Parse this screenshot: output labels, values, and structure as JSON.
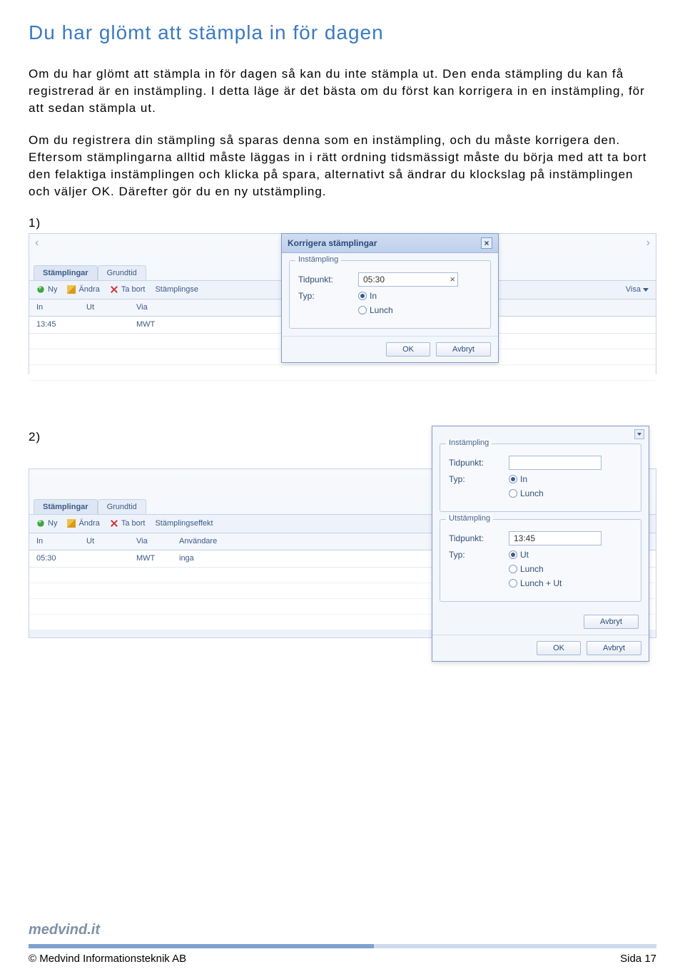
{
  "title": "Du har glömt att stämpla in för dagen",
  "para1": "Om du har glömt att stämpla in för dagen så kan du inte stämpla ut. Den enda stämpling du kan få registrerad är en instämpling. I detta läge är det bästa om du först kan korrigera in en instämpling, för att sedan stämpla ut.",
  "para2": "Om du registrera din stämpling så sparas denna som en instämpling, och du måste korrigera den. Eftersom stämplingarna alltid måste läggas in i rätt ordning tidsmässigt måste du börja med att ta bort den felaktiga instämplingen och klicka på spara, alternativt så ändrar du klockslag på instämplingen och väljer OK. Därefter gör du en ny utstämpling.",
  "step1": "1)",
  "step2": "2)",
  "common": {
    "tabs": {
      "stamplingar": "Stämplingar",
      "grundtid": "Grundtid"
    },
    "toolbar": {
      "ny": "Ny",
      "andra": "Ändra",
      "tabort": "Ta bort",
      "visa": "Visa"
    },
    "ok": "OK",
    "avbryt": "Avbryt",
    "tidpunkt": "Tidpunkt:",
    "typ": "Typ:"
  },
  "shot1": {
    "toolbar_effect": "Stämplingse",
    "headers": {
      "in": "In",
      "ut": "Ut",
      "via": "Via"
    },
    "row": {
      "in": "13:45",
      "ut": "",
      "via": "MWT"
    },
    "dialog": {
      "title": "Korrigera stämplingar",
      "legend": "Instämpling",
      "tidpunkt_value": "05:30",
      "in": "In",
      "lunch": "Lunch"
    }
  },
  "shot2": {
    "toolbar_effect": "Stämplingseffekt",
    "headers": {
      "in": "In",
      "ut": "Ut",
      "via": "Via",
      "anv": "Användare"
    },
    "row": {
      "in": "05:30",
      "ut": "",
      "via": "MWT",
      "anv": "inga"
    },
    "dialog": {
      "legend_in": "Instämpling",
      "in_tidpunkt": "",
      "in_in": "In",
      "in_lunch": "Lunch",
      "legend_ut": "Utstämpling",
      "ut_tidpunkt": "13:45",
      "ut_ut": "Ut",
      "ut_lunch": "Lunch",
      "ut_lunchut": "Lunch + Ut"
    }
  },
  "footer": {
    "brand": "medvind.it",
    "copyright": "© Medvind Informationsteknik AB",
    "page": "Sida 17"
  }
}
